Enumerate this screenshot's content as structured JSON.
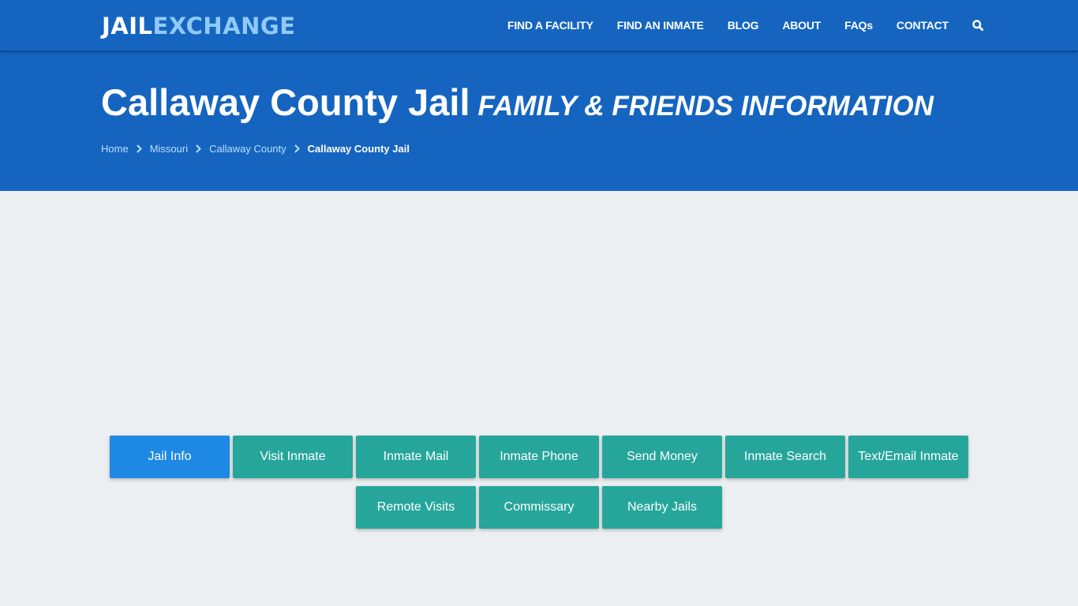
{
  "header": {
    "logo_part1": "JAIL",
    "logo_part2": "EXCHANGE",
    "nav": [
      {
        "label": "FIND A FACILITY"
      },
      {
        "label": "FIND AN INMATE"
      },
      {
        "label": "BLOG"
      },
      {
        "label": "ABOUT"
      },
      {
        "label": "FAQs"
      },
      {
        "label": "CONTACT"
      }
    ],
    "search_icon": "search-icon"
  },
  "hero": {
    "title": "Callaway County Jail",
    "subtitle": "FAMILY & FRIENDS INFORMATION",
    "breadcrumb": [
      "Home",
      "Missouri",
      "Callaway County",
      "Callaway County Jail"
    ]
  },
  "buttons": {
    "row1": [
      "Jail Info",
      "Visit Inmate",
      "Inmate Mail",
      "Inmate Phone",
      "Send Money",
      "Inmate Search",
      "Text/Email Inmate"
    ],
    "row2": [
      "Remote Visits",
      "Commissary",
      "Nearby Jails"
    ],
    "active": "Jail Info"
  },
  "colors": {
    "primary": "#1565c0",
    "active_button": "#1e88e5",
    "button": "#26a69a",
    "background": "#eceff1"
  }
}
